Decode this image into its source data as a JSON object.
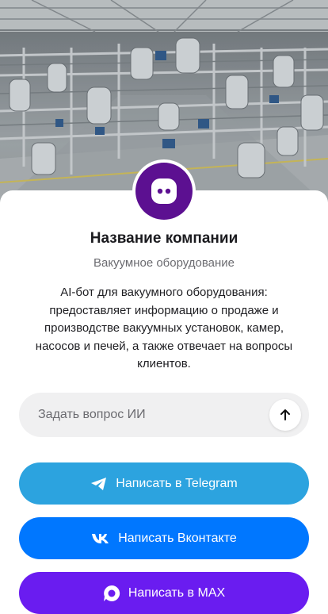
{
  "header": {
    "image": "industrial-vacuum-plant-photo"
  },
  "company": {
    "avatar_icon": "chat-bot-icon",
    "avatar_color": "#5c1091",
    "name": "Название компании",
    "subtitle": "Вакуумное оборудование",
    "description": "AI-бот для вакуумного оборудования: предоставляет информацию о продаже и производстве вакуумных установок, камер, насосов и печей, а также отвечает на вопросы клиентов."
  },
  "ask": {
    "placeholder": "Задать вопрос ИИ",
    "value": "",
    "send_icon": "arrow-up-icon"
  },
  "buttons": {
    "telegram": {
      "label": "Написать в Telegram",
      "icon": "telegram-icon",
      "color": "#2ca3df"
    },
    "vk": {
      "label": "Написать Вконтакте",
      "icon": "vk-icon",
      "color": "#0077ff"
    },
    "max": {
      "label": "Написать в MAX",
      "icon": "max-icon",
      "color": "#6a1cf0"
    }
  }
}
